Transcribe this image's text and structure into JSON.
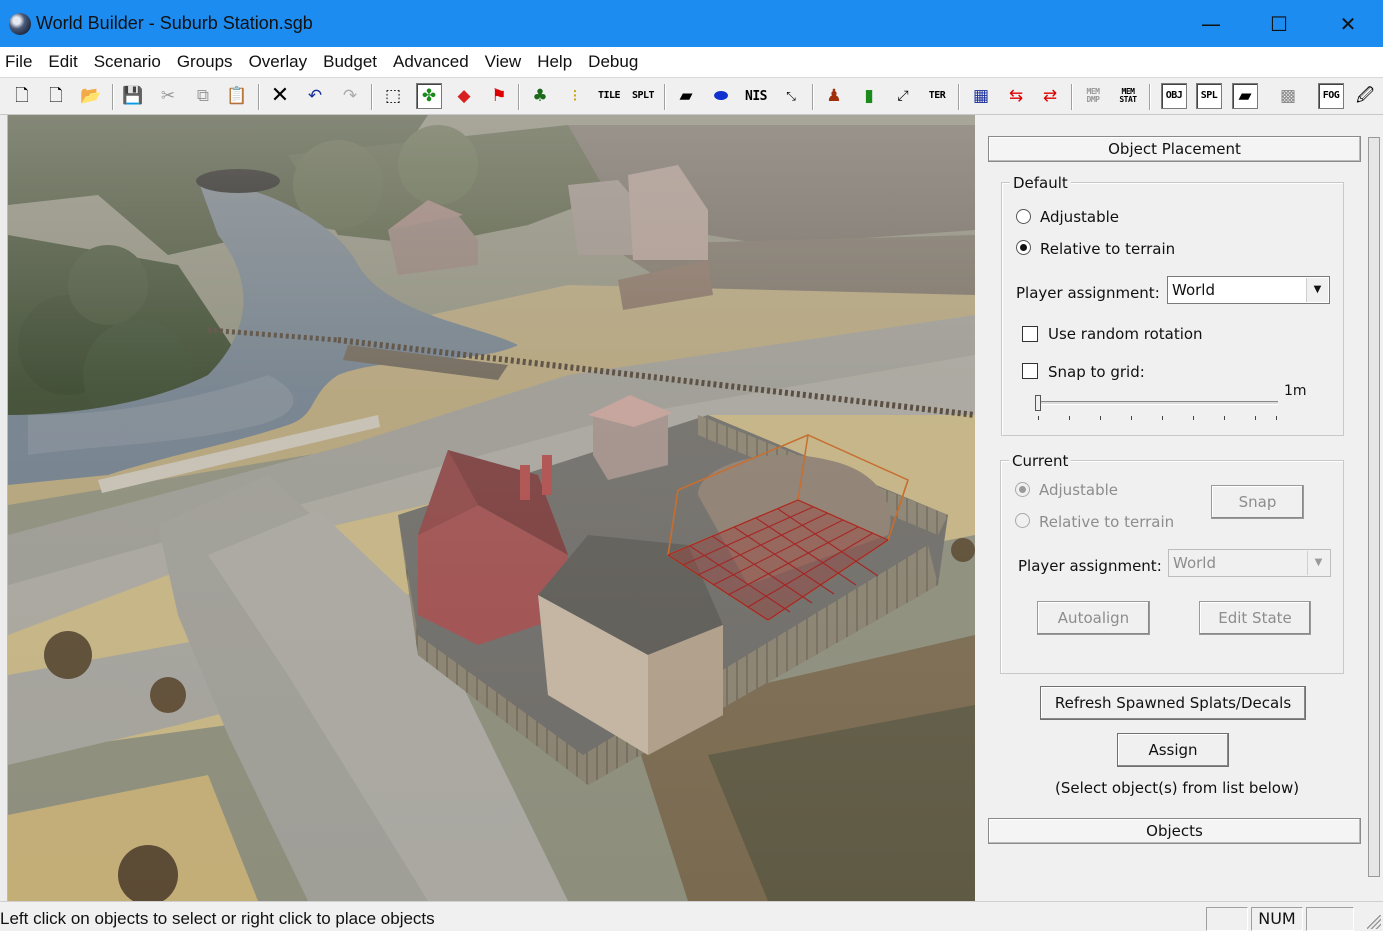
{
  "window": {
    "title": "World Builder - Suburb Station.sgb",
    "controls": {
      "minimize": "—",
      "maximize": "☐",
      "close": "✕"
    }
  },
  "menu": [
    "File",
    "Edit",
    "Scenario",
    "Groups",
    "Overlay",
    "Budget",
    "Advanced",
    "View",
    "Help",
    "Debug"
  ],
  "toolbar": {
    "text_buttons": {
      "tile": "TILE",
      "splt": "SPLT",
      "nis": "NIS",
      "ter": "TER",
      "mem_dmp": "MEM DMP",
      "mem_stat": "MEM STAT",
      "obj": "OBJ",
      "spl": "SPL",
      "fog": "FOG"
    }
  },
  "panel": {
    "object_placement_header": "Object Placement",
    "default_group": {
      "legend": "Default",
      "adjustable": "Adjustable",
      "relative_to_terrain": "Relative to terrain",
      "selected_mode": "Relative to terrain",
      "player_assignment_label": "Player assignment:",
      "player_assignment_value": "World",
      "use_random_rotation": "Use random rotation",
      "use_random_rotation_checked": false,
      "snap_to_grid": "Snap to grid:",
      "snap_to_grid_checked": false,
      "snap_value_label": "1m",
      "snap_slider_position": 0
    },
    "current_group": {
      "legend": "Current",
      "adjustable": "Adjustable",
      "relative_to_terrain": "Relative to terrain",
      "selected_mode": "Adjustable",
      "snap_button": "Snap",
      "player_assignment_label": "Player assignment:",
      "player_assignment_value": "World",
      "autoalign_button": "Autoalign",
      "edit_state_button": "Edit State"
    },
    "refresh_button": "Refresh Spawned Splats/Decals",
    "assign_button": "Assign",
    "assign_hint": "(Select object(s) from list below)",
    "objects_header": "Objects"
  },
  "statusbar": {
    "message": "Left click on objects to select or right click to place objects",
    "num_indicator": "NUM"
  },
  "colors": {
    "titlebar": "#1c8cf0",
    "selection_box": "#c8641e",
    "placement_grid": "#a01818"
  }
}
